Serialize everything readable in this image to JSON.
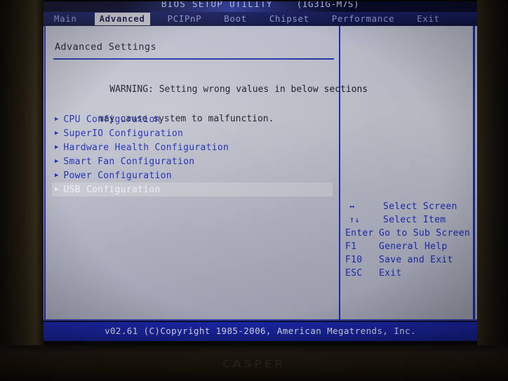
{
  "photo": {
    "monitor_brand": "CASPER"
  },
  "bios": {
    "title": "BIOS SETUP UTILITY",
    "model": "(IG31G-M7S)",
    "menu_tabs": [
      {
        "label": "Main",
        "active": false
      },
      {
        "label": "Advanced",
        "active": true
      },
      {
        "label": "PCIPnP",
        "active": false
      },
      {
        "label": "Boot",
        "active": false
      },
      {
        "label": "Chipset",
        "active": false
      },
      {
        "label": "Performance",
        "active": false
      },
      {
        "label": "Exit",
        "active": false
      }
    ],
    "page_title": "Advanced Settings",
    "warning_line1": "WARNING: Setting wrong values in below sections",
    "warning_line2": "may cause system to malfunction.",
    "items": [
      {
        "label": "CPU Configuration",
        "selected": false
      },
      {
        "label": "SuperIO Configuration",
        "selected": false
      },
      {
        "label": "Hardware Health Configuration",
        "selected": false
      },
      {
        "label": "Smart Fan Configuration",
        "selected": false
      },
      {
        "label": "Power Configuration",
        "selected": false
      },
      {
        "label": "USB Configuration",
        "selected": true
      }
    ],
    "key_help": [
      {
        "key": "↔",
        "desc": "Select Screen",
        "glyph": true
      },
      {
        "key": "↑↓",
        "desc": "Select Item",
        "glyph": true
      },
      {
        "key": "Enter",
        "desc": "Go to Sub Screen",
        "glyph": false
      },
      {
        "key": "F1",
        "desc": "General Help",
        "glyph": false
      },
      {
        "key": "F10",
        "desc": "Save and Exit",
        "glyph": false
      },
      {
        "key": "ESC",
        "desc": "Exit",
        "glyph": false
      }
    ],
    "footer": "v02.61 (C)Copyright 1985-2006, American Megatrends, Inc.",
    "colors": {
      "accent_blue": "#1d2bb8",
      "menubar_blue": "#191f63",
      "footer_blue": "#1c28ac",
      "panel_gray": "#c2c4ce",
      "highlight_gray": "#c9c9d2"
    }
  }
}
